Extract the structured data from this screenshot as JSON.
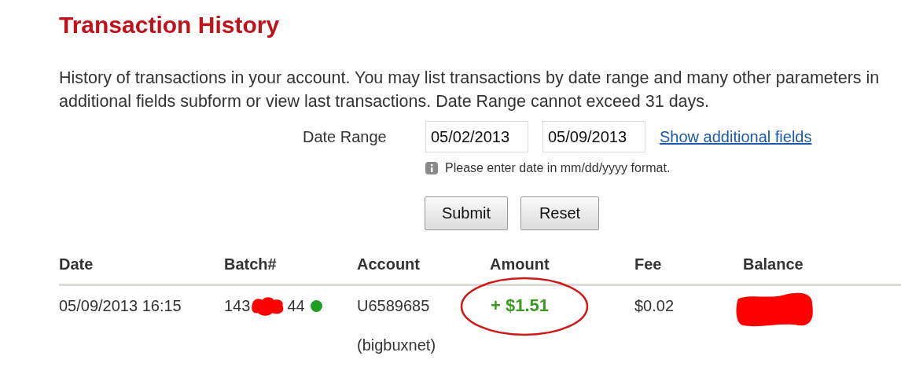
{
  "title": "Transaction History",
  "intro": "History of transactions in your account. You may list transactions by date range and many other parameters in additional fields subform or view last transactions. Date Range cannot exceed 31 days.",
  "filter": {
    "label": "Date Range",
    "from": "05/02/2013",
    "to": "05/09/2013",
    "link": "Show additional fields",
    "hint": "Please enter date in mm/dd/yyyy format."
  },
  "buttons": [
    "Submit",
    "Reset"
  ],
  "table": {
    "columns": [
      "Date",
      "Batch#",
      "Account",
      "Amount",
      "Fee",
      "Balance"
    ],
    "rows": [
      {
        "date": "05/09/2013 16:15",
        "batch_start": "143",
        "batch_end": "44",
        "account": "U6589685",
        "account_name": "(bigbuxnet)",
        "amount": "+ $1.51",
        "fee": "$0.02"
      }
    ]
  }
}
